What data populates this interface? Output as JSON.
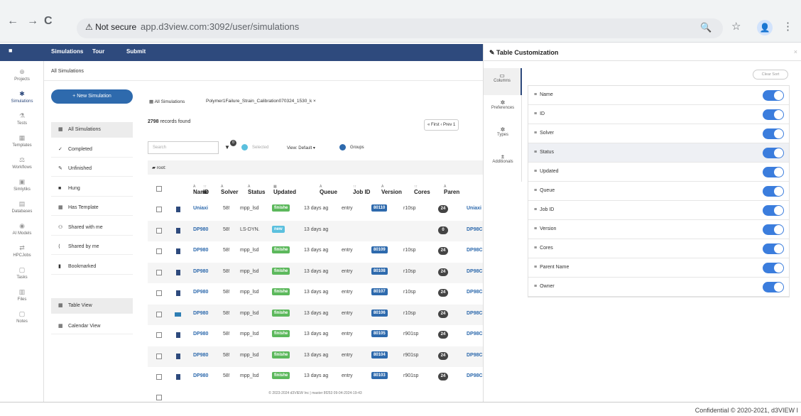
{
  "browser": {
    "back": "←",
    "forward": "→",
    "reload": "C",
    "not_secure": "⚠ Not secure",
    "url": "app.d3view.com:3092/user/simulations",
    "zoom": "🔍",
    "star": "☆",
    "menu": "⋮",
    "avatar": "👤"
  },
  "topbar": {
    "simulations": "Simulations",
    "tour": "Tour",
    "submit": "Submit"
  },
  "leftnav": [
    {
      "icon": "⊕",
      "label": "Projects"
    },
    {
      "icon": "✱",
      "label": "Simulations"
    },
    {
      "icon": "⚗",
      "label": "Tests"
    },
    {
      "icon": "▦",
      "label": "Templates"
    },
    {
      "icon": "⚖",
      "label": "Workflows"
    },
    {
      "icon": "▣",
      "label": "Simlytiks"
    },
    {
      "icon": "▤",
      "label": "Databases"
    },
    {
      "icon": "◉",
      "label": "AI Models"
    },
    {
      "icon": "⇄",
      "label": "HPCJobs"
    },
    {
      "icon": "▢",
      "label": "Tasks"
    },
    {
      "icon": "▥",
      "label": "Files"
    },
    {
      "icon": "▢",
      "label": "Notes"
    }
  ],
  "breadcrumb": "All Simulations",
  "new_simulation": "+ New Simulation",
  "filters": [
    {
      "icon": "▦",
      "label": "All Simulations"
    },
    {
      "icon": "✓",
      "label": "Completed"
    },
    {
      "icon": "✎",
      "label": "Unfinished"
    },
    {
      "icon": "■",
      "label": "Hung"
    },
    {
      "icon": "▦",
      "label": "Has Template"
    },
    {
      "icon": "⚇",
      "label": "Shared with me"
    },
    {
      "icon": "⟨",
      "label": "Shared by me"
    },
    {
      "icon": "▮",
      "label": "Bookmarked"
    }
  ],
  "views": [
    {
      "icon": "▦",
      "label": "Table View"
    },
    {
      "icon": "▦",
      "label": "Calendar View"
    }
  ],
  "tabs": {
    "all": "▦ All Simulations",
    "open": "Polymer1Failure_Strain_Calibration070324_1530_k ×"
  },
  "records": {
    "count": "2798",
    "suffix": "records found"
  },
  "pager": "« First   ‹ Prev   1",
  "toolbar": {
    "search": "Search",
    "filter_badge": "0",
    "selected": "Selected",
    "view": "View: Default ▾",
    "groups": "Groups"
  },
  "root": "root:",
  "columns": [
    {
      "sort": "A",
      "label": "Name"
    },
    {
      "sort": "↑↑",
      "label": "ID"
    },
    {
      "sort": "A",
      "label": "Solver"
    },
    {
      "sort": "A",
      "label": "Status"
    },
    {
      "sort": "▦",
      "label": "Updated"
    },
    {
      "sort": "A",
      "label": "Queue"
    },
    {
      "sort": "↑↑",
      "label": "Job ID"
    },
    {
      "sort": "A",
      "label": "Version"
    },
    {
      "sort": "↑↑",
      "label": "Cores"
    },
    {
      "sort": "A",
      "label": "Paren"
    }
  ],
  "rows": [
    {
      "name": "Uniaxi",
      "id": "58!",
      "solver": "mpp_lsd",
      "status": "finishe",
      "updated": "13 days ag",
      "queue": "entry",
      "job": "80110",
      "version": "r10sp",
      "cores": "24",
      "parent": "Uniaxi",
      "folder": false
    },
    {
      "name": "DP980",
      "id": "58!",
      "solver": "LS-DYN.",
      "status": "new",
      "updated": "13 days ag",
      "queue": "",
      "job": "",
      "version": "",
      "cores": "0",
      "parent": "DP98C",
      "folder": false
    },
    {
      "name": "DP980",
      "id": "58!",
      "solver": "mpp_lsd",
      "status": "finishe",
      "updated": "13 days ag",
      "queue": "entry",
      "job": "80109",
      "version": "r10sp",
      "cores": "24",
      "parent": "DP98C",
      "folder": false
    },
    {
      "name": "DP980",
      "id": "58!",
      "solver": "mpp_lsd",
      "status": "finishe",
      "updated": "13 days ag",
      "queue": "entry",
      "job": "80108",
      "version": "r10sp",
      "cores": "24",
      "parent": "DP98C",
      "folder": false
    },
    {
      "name": "DP980",
      "id": "58!",
      "solver": "mpp_lsd",
      "status": "finishe",
      "updated": "13 days ag",
      "queue": "entry",
      "job": "80107",
      "version": "r10sp",
      "cores": "24",
      "parent": "DP98C",
      "folder": false
    },
    {
      "name": "DP980",
      "id": "58!",
      "solver": "mpp_lsd",
      "status": "finishe",
      "updated": "13 days ag",
      "queue": "entry",
      "job": "80106",
      "version": "r10sp",
      "cores": "24",
      "parent": "DP98C",
      "folder": true
    },
    {
      "name": "DP980",
      "id": "58!",
      "solver": "mpp_lsd",
      "status": "finishe",
      "updated": "13 days ag",
      "queue": "entry",
      "job": "80105",
      "version": "r901sp",
      "cores": "24",
      "parent": "DP98C",
      "folder": false
    },
    {
      "name": "DP980",
      "id": "58!",
      "solver": "mpp_lsd",
      "status": "finishe",
      "updated": "13 days ag",
      "queue": "entry",
      "job": "80104",
      "version": "r901sp",
      "cores": "24",
      "parent": "DP98C",
      "folder": false
    },
    {
      "name": "DP980",
      "id": "58!",
      "solver": "mpp_lsd",
      "status": "finishe",
      "updated": "13 days ag",
      "queue": "entry",
      "job": "80103",
      "version": "r901sp",
      "cores": "24",
      "parent": "DP98C",
      "folder": false
    }
  ],
  "footer": "© 2023-2024 d3VIEW Inc | master 8f253 09-04-2024-19-43",
  "panel": {
    "title": "Table Customization",
    "close": "×",
    "clear_sort": "Clear Sort",
    "tabs": [
      {
        "icon": "▭",
        "label": "Columns"
      },
      {
        "icon": "✲",
        "label": "Preferences"
      },
      {
        "icon": "✲",
        "label": "Types"
      },
      {
        "icon": "±",
        "label": "Additionals"
      }
    ],
    "columns": [
      "Name",
      "ID",
      "Solver",
      "Status",
      "Updated",
      "Queue",
      "Job ID",
      "Version",
      "Cores",
      "Parent Name",
      "Owner"
    ]
  },
  "confidential": "Confidential © 2020-2021, d3VIEW I",
  "colors": {
    "accent": "#2e4a7d",
    "finished": "#5cb85c",
    "toggle": "#3b7ddd"
  }
}
